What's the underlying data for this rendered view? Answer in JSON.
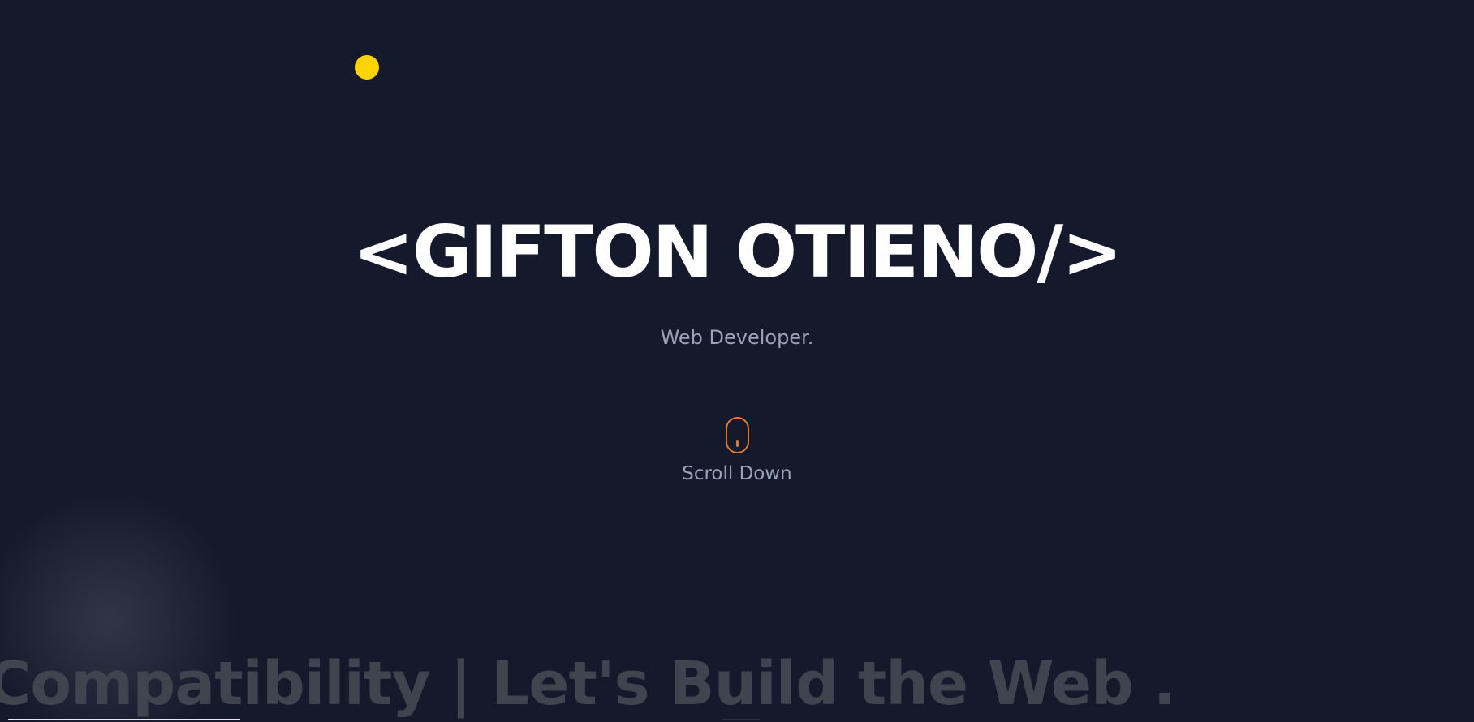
{
  "hero": {
    "name": "<GIFTON OTIENO/>",
    "subtitle": "Web Developer."
  },
  "scroll_hint": {
    "label": "Scroll Down",
    "icon": "mouse-icon"
  },
  "marquee": {
    "text": "Compatibility | Let's Build the Web ."
  },
  "colors": {
    "background": "#141a2c",
    "cursor_dot": "#ffd400",
    "accent": "#e07a2c",
    "hero_text": "#ffffff",
    "muted_text": "#9aa4b6",
    "marquee_text": "#40444f"
  }
}
